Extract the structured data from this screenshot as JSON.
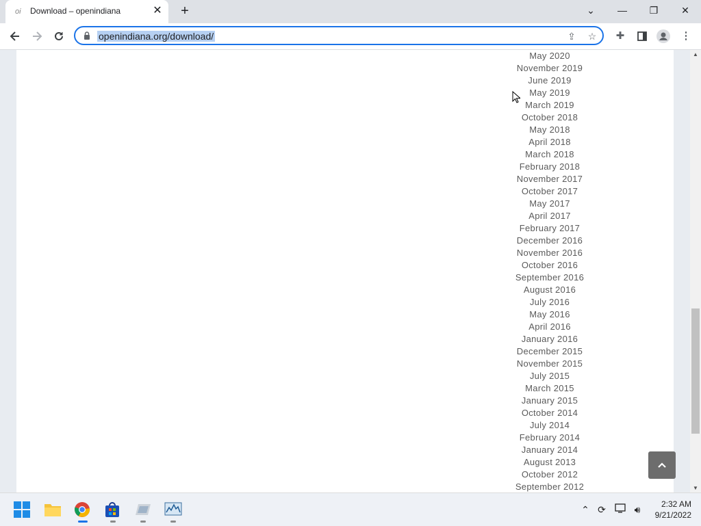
{
  "browser": {
    "tab_title": "Download – openindiana",
    "favicon_text": "oi",
    "tab_close": "✕",
    "new_tab": "+",
    "url": "openindiana.org/download/"
  },
  "window_controls": {
    "tablist": "⌄",
    "minimize": "—",
    "maximize": "❐",
    "close": "✕"
  },
  "archive_months": [
    "May 2020",
    "November 2019",
    "June 2019",
    "May 2019",
    "March 2019",
    "October 2018",
    "May 2018",
    "April 2018",
    "March 2018",
    "February 2018",
    "November 2017",
    "October 2017",
    "May 2017",
    "April 2017",
    "February 2017",
    "December 2016",
    "November 2016",
    "October 2016",
    "September 2016",
    "August 2016",
    "July 2016",
    "May 2016",
    "April 2016",
    "January 2016",
    "December 2015",
    "November 2015",
    "July 2015",
    "March 2015",
    "January 2015",
    "October 2014",
    "July 2014",
    "February 2014",
    "January 2014",
    "August 2013",
    "October 2012",
    "September 2012"
  ],
  "taskbar": {
    "time": "2:32 AM",
    "date": "9/21/2022"
  },
  "colors": {
    "accent": "#1a73e8",
    "url_highlight": "#b6d0f2",
    "link_text": "#5a5a5a",
    "back_to_top": "#6d6d6d"
  }
}
